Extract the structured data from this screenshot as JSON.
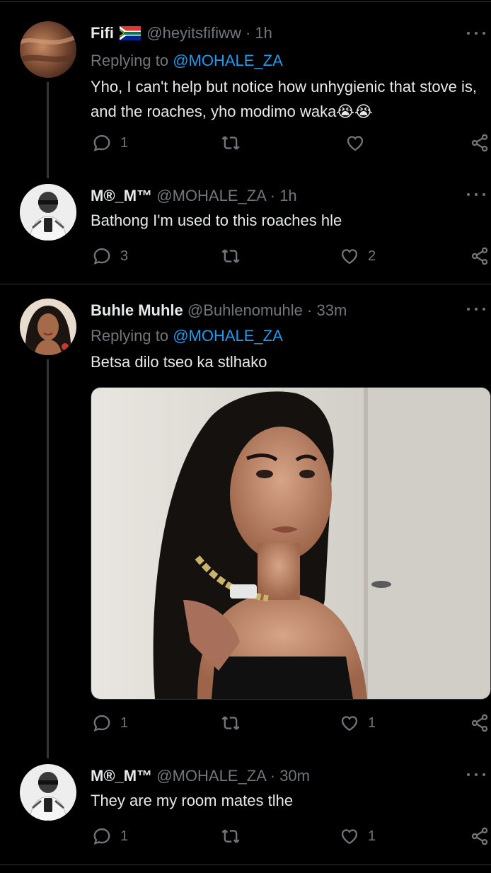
{
  "tweets": [
    {
      "name": "Fifi",
      "handle": "@heyitsfifiww",
      "time": "1h",
      "replying_prefix": "Replying to ",
      "replying_to": "@MOHALE_ZA",
      "text": "Yho, I can't help but notice how unhygienic that stove is, and the roaches, yho modimo waka😭😭",
      "replies": "1",
      "retweets": "",
      "likes": ""
    },
    {
      "name": "M®_M™",
      "handle": "@MOHALE_ZA",
      "time": "1h",
      "text": "Bathong I'm used to this roaches hle",
      "replies": "3",
      "retweets": "",
      "likes": "2"
    },
    {
      "name": "Buhle Muhle",
      "handle": "@Buhlenomuhle",
      "time": "33m",
      "replying_prefix": "Replying to ",
      "replying_to": "@MOHALE_ZA",
      "text": "Betsa dilo tseo ka stlhako",
      "replies": "1",
      "retweets": "",
      "likes": "1"
    },
    {
      "name": "M®_M™",
      "handle": "@MOHALE_ZA",
      "time": "30m",
      "text": "They are my room mates tlhe",
      "replies": "1",
      "retweets": "",
      "likes": "1"
    }
  ],
  "separator": " · ",
  "colors": {
    "background": "#000000",
    "text": "#e7e9ea",
    "muted": "#71767b",
    "accent": "#1d9bf0",
    "divider": "#2f3336"
  },
  "icons": [
    "reply-icon",
    "retweet-icon",
    "like-icon",
    "share-icon",
    "more-icon",
    "south-africa-flag-icon"
  ]
}
